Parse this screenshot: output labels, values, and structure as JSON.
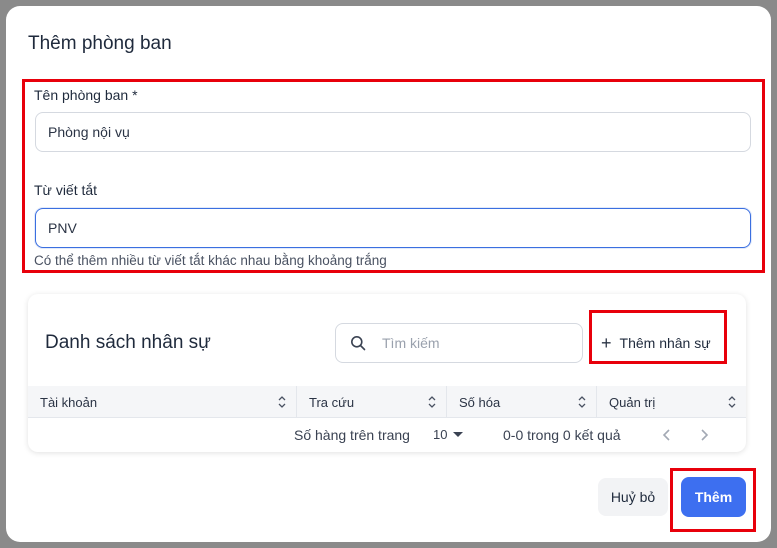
{
  "dialog": {
    "title": "Thêm phòng ban"
  },
  "form": {
    "name_label": "Tên phòng ban *",
    "name_value": "Phòng nội vụ",
    "abbr_label": "Từ viết tắt",
    "abbr_value": "PNV",
    "abbr_helper": "Có thể thêm nhiều từ viết tắt khác nhau bằng khoảng trắng"
  },
  "staff": {
    "title": "Danh sách nhân sự",
    "search_placeholder": "Tìm kiếm",
    "add_label": "Thêm nhân sự",
    "columns": [
      "Tài khoản",
      "Tra cứu",
      "Số hóa",
      "Quản trị"
    ],
    "rows": [],
    "pagination": {
      "rows_label": "Số hàng trên trang",
      "rows_per_page": "10",
      "range": "0-0 trong 0 kết quả"
    }
  },
  "footer": {
    "cancel_label": "Huỷ bỏ",
    "submit_label": "Thêm"
  },
  "colors": {
    "primary": "#3d6ff0",
    "highlight": "#e8000b"
  },
  "icons": {
    "search": "search-icon",
    "plus": "plus-icon",
    "sort": "sort-icon",
    "prev": "chevron-left-icon",
    "next": "chevron-right-icon",
    "caret": "caret-down-icon"
  }
}
